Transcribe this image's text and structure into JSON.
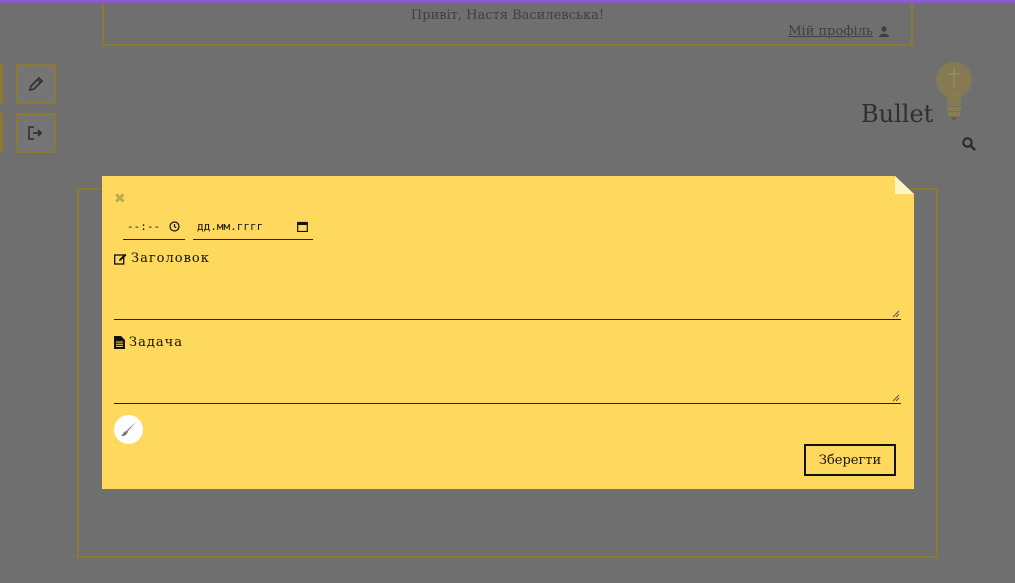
{
  "header": {
    "greeting": "Привіт, Настя Василевська!",
    "profile_label": "Мій профіль"
  },
  "brand": {
    "name": "Bullet"
  },
  "sidebar": {
    "items": [
      {
        "icon": "pencil-icon"
      },
      {
        "icon": "sign-out-icon"
      }
    ]
  },
  "modal": {
    "time_placeholder": "--:--",
    "date_placeholder": "дд.мм.гггг",
    "title_label": "Заголовок",
    "title_value": "",
    "task_label": "Задача",
    "task_value": "",
    "save_label": "Зберегти"
  },
  "colors": {
    "modal_bg": "#ffd95e",
    "overlay": "#6f6f6f",
    "accent_border": "#8c7a33",
    "top_accent": "#8a5cc7"
  }
}
